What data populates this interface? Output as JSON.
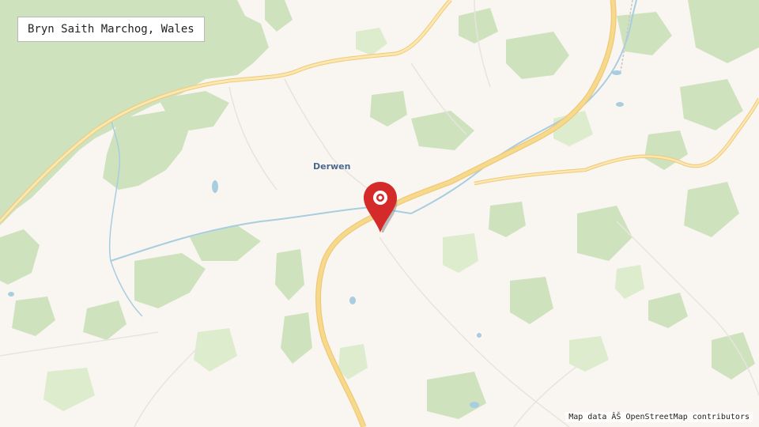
{
  "title": "Bryn Saith Marchog, Wales",
  "place_label": "Derwen",
  "attribution": "Map data ÂŠ OpenStreetMap contributors",
  "marker": {
    "icon": "map-pin-icon",
    "color": "#d42a2a"
  },
  "colors": {
    "land": "#f9f6f1",
    "forest": "#cfe2be",
    "park": "#dceccd",
    "major_road": "#f6d98a",
    "major_road_casing": "#efc978",
    "minor_road": "#e7e4de",
    "water": "#a8cde0",
    "label": "#4a6787"
  }
}
